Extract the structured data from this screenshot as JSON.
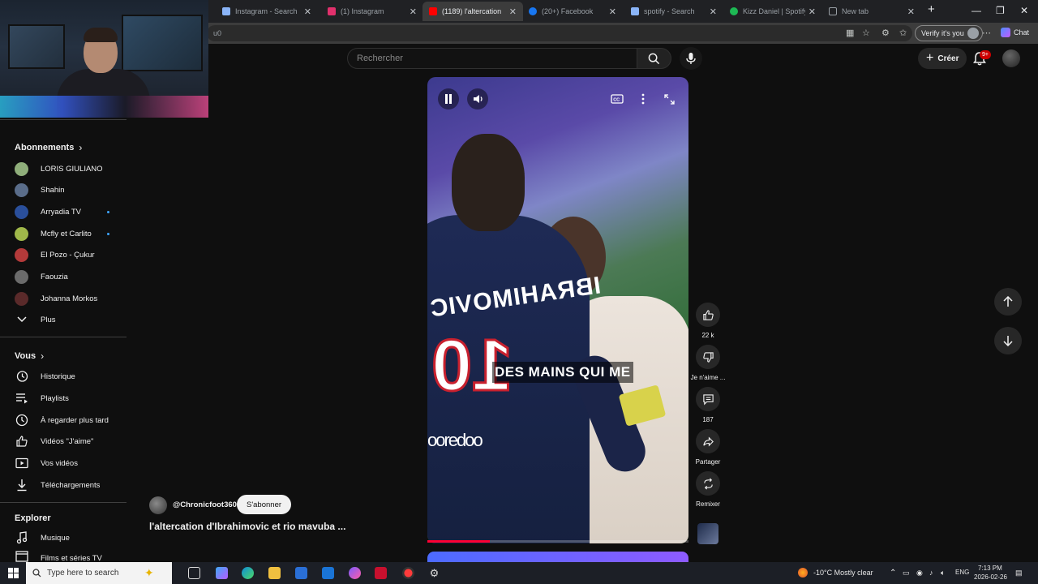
{
  "browser": {
    "tabs": [
      {
        "label": "Instagram - Search",
        "icon_color": "#8ab4f8",
        "active": false
      },
      {
        "label": "(1) Instagram",
        "icon_color": "#e1306c",
        "active": false
      },
      {
        "label": "(1189) l'altercation",
        "icon_color": "#ff0000",
        "active": true
      },
      {
        "label": "(20+) Facebook",
        "icon_color": "#1877f2",
        "active": false
      },
      {
        "label": "spotify - Search",
        "icon_color": "#8ab4f8",
        "active": false
      },
      {
        "label": "Kizz Daniel | Spotify",
        "icon_color": "#1db954",
        "active": false
      },
      {
        "label": "New tab",
        "icon_color": "#9aa0a6",
        "active": false
      }
    ],
    "url_fragment": "u0",
    "verify_label": "Verify it's you",
    "chat_label": "Chat",
    "new_tab_symbol": "+",
    "close_symbol": "✕",
    "minimize_symbol": "—",
    "restore_symbol": "❐"
  },
  "header": {
    "search_placeholder": "Rechercher",
    "create_label": "Créer",
    "notif_badge": "9+"
  },
  "sidebar": {
    "subscriptions_title": "Abonnements",
    "subscriptions": [
      {
        "name": "LORIS GIULIANO",
        "color": "#8fae7a",
        "live": false
      },
      {
        "name": "Shahin",
        "color": "#5a6d8a",
        "live": false
      },
      {
        "name": "Arryadia TV",
        "color": "#2a4f9b",
        "live": true
      },
      {
        "name": "Mcfly et Carlito",
        "color": "#a0b84a",
        "live": true
      },
      {
        "name": "El Pozo - Çukur",
        "color": "#b33a3a",
        "live": false
      },
      {
        "name": "Faouzia",
        "color": "#6b6b6b",
        "live": false
      },
      {
        "name": "Johanna Morkos",
        "color": "#5a2a2a",
        "live": false
      }
    ],
    "more_label": "Plus",
    "you_title": "Vous",
    "you_items": [
      {
        "label": "Historique",
        "icon": "history-icon"
      },
      {
        "label": "Playlists",
        "icon": "playlists-icon"
      },
      {
        "label": "À regarder plus tard",
        "icon": "watch-later-icon"
      },
      {
        "label": "Vidéos \"J'aime\"",
        "icon": "thumbs-up-icon"
      },
      {
        "label": "Vos vidéos",
        "icon": "your-videos-icon"
      },
      {
        "label": "Téléchargements",
        "icon": "download-icon"
      }
    ],
    "explore_title": "Explorer",
    "explore_items": [
      {
        "label": "Musique",
        "icon": "music-icon"
      },
      {
        "label": "Films et séries TV",
        "icon": "film-icon"
      }
    ]
  },
  "video": {
    "caption": "DES MAINS QUI ME",
    "jersey_name": "IBRAHIMOVIC",
    "jersey_number": "10",
    "sponsor": "ooredoo",
    "progress": 0.24
  },
  "actions": {
    "likes": "22 k",
    "dislike_label": "Je n'aime ...",
    "comments": "187",
    "share_label": "Partager",
    "remix_label": "Remixer"
  },
  "channel": {
    "handle": "@Chronicfoot360",
    "subscribe_label": "S'abonner",
    "video_title": "l'altercation d'Ibrahimovic et rio mavuba ..."
  },
  "taskbar": {
    "search_placeholder": "Type here to search",
    "weather": "-10°C  Mostly clear",
    "language": "ENG",
    "time": "7:13 PM",
    "date": "2026-02-26"
  },
  "colors": {
    "accent_red": "#ff0033",
    "live_dot": "#3ea6ff",
    "background": "#0f0f0f"
  }
}
